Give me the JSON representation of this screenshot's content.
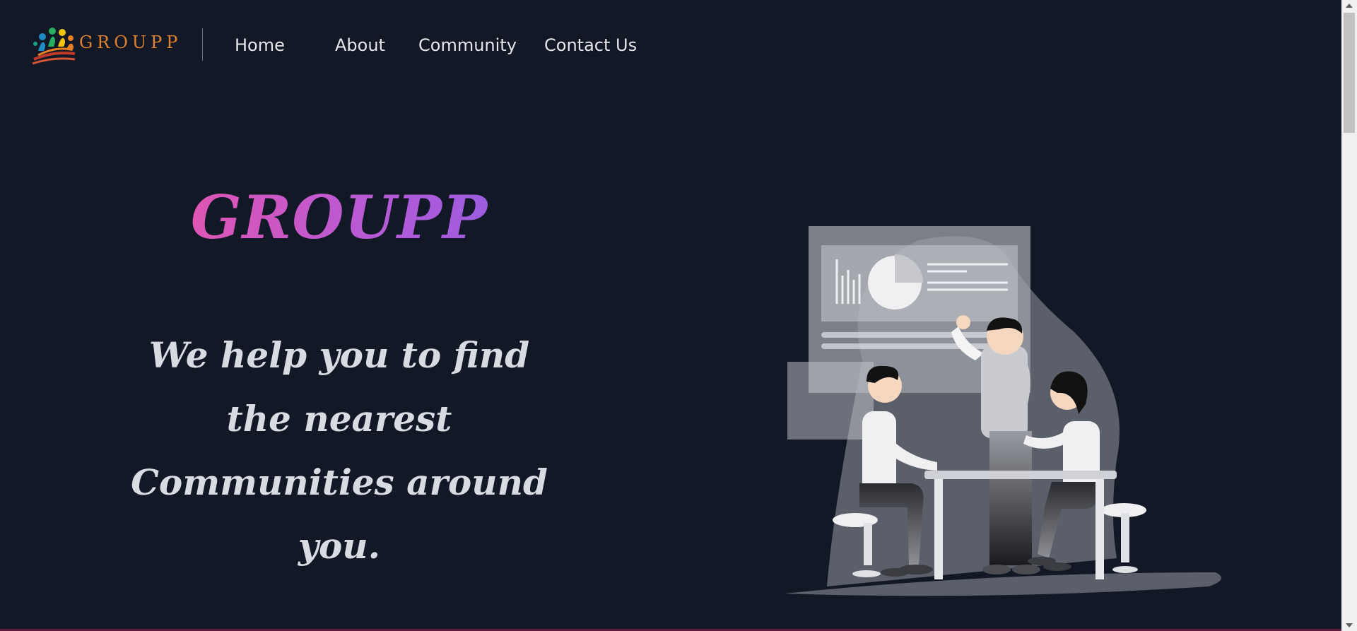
{
  "nav": {
    "logo_text": "GROUPP",
    "links": [
      "Home",
      "About",
      "Community",
      "Contact Us"
    ]
  },
  "hero": {
    "title": "GROUPP",
    "tagline": "We help you to find the nearest Communities around you."
  },
  "colors": {
    "background": "#131827",
    "logo_text": "#e0822e",
    "title_gradient_start": "#e055b3",
    "title_gradient_end": "#9b5ce0",
    "tagline": "#d8dbe2",
    "nav_text": "#e6e6ea"
  },
  "icons": {
    "logo": "rainbow-people-logo-icon"
  },
  "illustration": {
    "subject": "team-meeting-illustration"
  }
}
